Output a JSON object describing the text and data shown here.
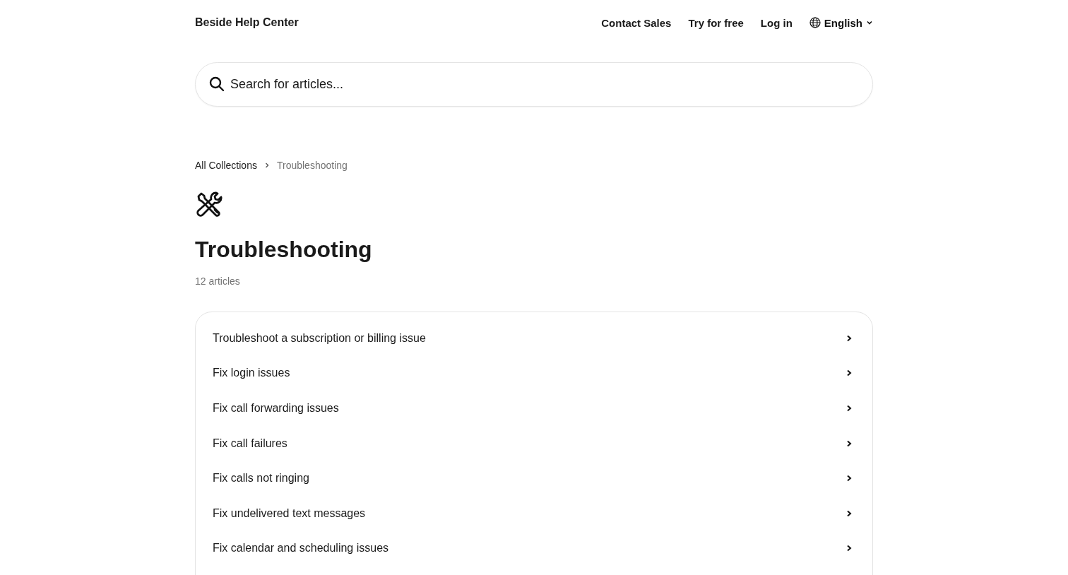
{
  "header": {
    "brand": "Beside Help Center",
    "nav": [
      "Contact Sales",
      "Try for free",
      "Log in"
    ],
    "language": "English"
  },
  "search": {
    "placeholder": "Search for articles..."
  },
  "breadcrumb": [
    "All Collections",
    "Troubleshooting"
  ],
  "collection": {
    "title": "Troubleshooting",
    "count": "12 articles"
  },
  "articles": [
    {
      "title": "Troubleshoot a subscription or billing issue"
    },
    {
      "title": "Fix login issues"
    },
    {
      "title": "Fix call forwarding issues"
    },
    {
      "title": "Fix call failures"
    },
    {
      "title": "Fix calls not ringing"
    },
    {
      "title": "Fix undelivered text messages"
    },
    {
      "title": "Fix calendar and scheduling issues"
    }
  ]
}
